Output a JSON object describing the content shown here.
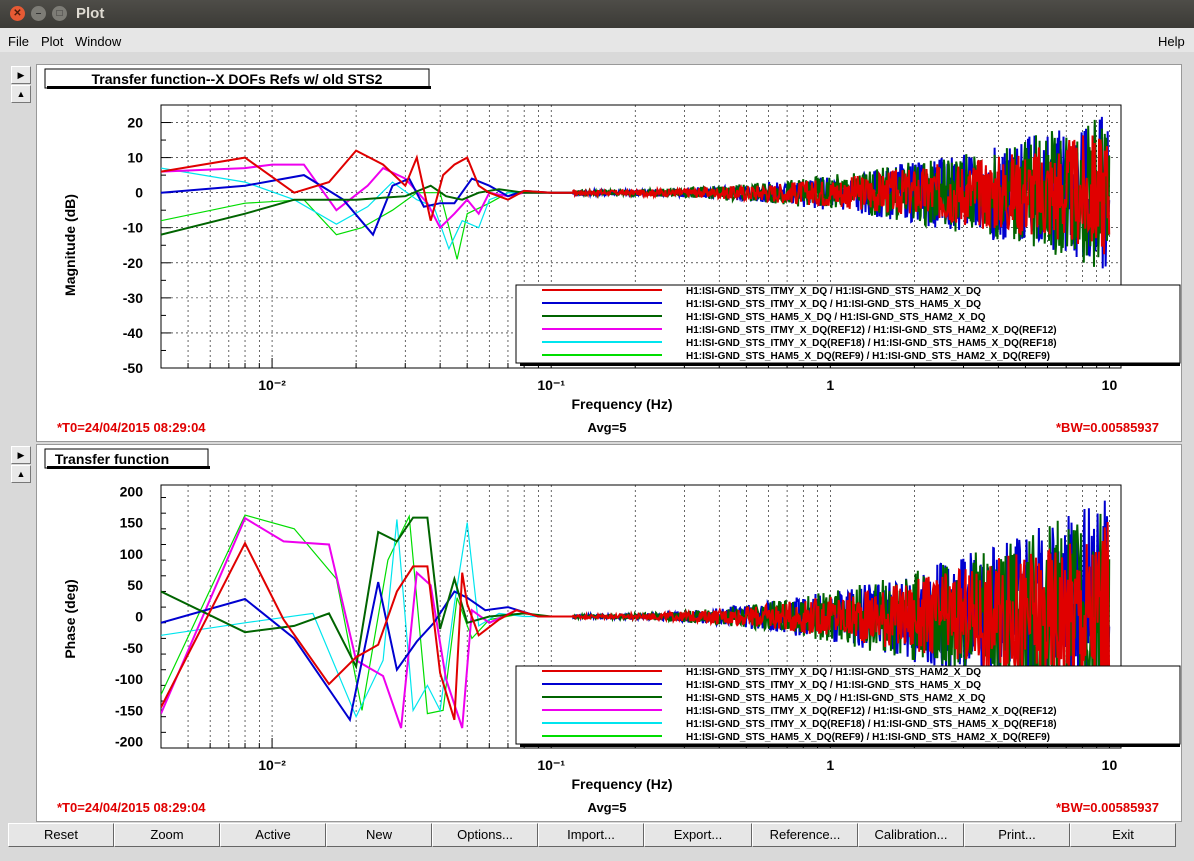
{
  "window": {
    "title": "Plot"
  },
  "menu": {
    "file": "File",
    "plot": "Plot",
    "window": "Window",
    "help": "Help"
  },
  "panels": [
    {
      "title": "Transfer function--X DOFs  Refs w/ old STS2",
      "ylabel": "Magnitude (dB)",
      "xlabel": "Frequency (Hz)",
      "yticks": [
        "20",
        "10",
        "0",
        "-10",
        "-20",
        "-30",
        "-40",
        "-50"
      ],
      "xticks": [
        "10⁻²",
        "10⁻¹",
        "1",
        "10"
      ],
      "t0": "*T0=24/04/2015 08:29:04",
      "avg": "Avg=5",
      "bw": "*BW=0.00585937",
      "legend": [
        {
          "label": "H1:ISI-GND_STS_ITMY_X_DQ / H1:ISI-GND_STS_HAM2_X_DQ",
          "color": "#e00000"
        },
        {
          "label": "H1:ISI-GND_STS_ITMY_X_DQ / H1:ISI-GND_STS_HAM5_X_DQ",
          "color": "#0000d0"
        },
        {
          "label": "H1:ISI-GND_STS_HAM5_X_DQ / H1:ISI-GND_STS_HAM2_X_DQ",
          "color": "#006400"
        },
        {
          "label": "H1:ISI-GND_STS_ITMY_X_DQ(REF12) / H1:ISI-GND_STS_HAM2_X_DQ(REF12)",
          "color": "#ee00ee"
        },
        {
          "label": "H1:ISI-GND_STS_ITMY_X_DQ(REF18) / H1:ISI-GND_STS_HAM5_X_DQ(REF18)",
          "color": "#00e5ee"
        },
        {
          "label": "H1:ISI-GND_STS_HAM5_X_DQ(REF9) / H1:ISI-GND_STS_HAM2_X_DQ(REF9)",
          "color": "#00dd00"
        }
      ]
    },
    {
      "title": "Transfer function",
      "ylabel": "Phase (deg)",
      "xlabel": "Frequency (Hz)",
      "yticks": [
        "200",
        "150",
        "100",
        "50",
        "0",
        "-50",
        "-100",
        "-150",
        "-200"
      ],
      "xticks": [
        "10⁻²",
        "10⁻¹",
        "1",
        "10"
      ],
      "t0": "*T0=24/04/2015 08:29:04",
      "avg": "Avg=5",
      "bw": "*BW=0.00585937",
      "legend": [
        {
          "label": "H1:ISI-GND_STS_ITMY_X_DQ / H1:ISI-GND_STS_HAM2_X_DQ",
          "color": "#e00000"
        },
        {
          "label": "H1:ISI-GND_STS_ITMY_X_DQ / H1:ISI-GND_STS_HAM5_X_DQ",
          "color": "#0000d0"
        },
        {
          "label": "H1:ISI-GND_STS_HAM5_X_DQ / H1:ISI-GND_STS_HAM2_X_DQ",
          "color": "#006400"
        },
        {
          "label": "H1:ISI-GND_STS_ITMY_X_DQ(REF12) / H1:ISI-GND_STS_HAM2_X_DQ(REF12)",
          "color": "#ee00ee"
        },
        {
          "label": "H1:ISI-GND_STS_ITMY_X_DQ(REF18) / H1:ISI-GND_STS_HAM5_X_DQ(REF18)",
          "color": "#00e5ee"
        },
        {
          "label": "H1:ISI-GND_STS_HAM5_X_DQ(REF9) / H1:ISI-GND_STS_HAM2_X_DQ(REF9)",
          "color": "#00dd00"
        }
      ]
    }
  ],
  "buttons": [
    "Reset",
    "Zoom",
    "Active",
    "New",
    "Options...",
    "Import...",
    "Export...",
    "Reference...",
    "Calibration...",
    "Print...",
    "Exit"
  ],
  "chart_data": [
    {
      "type": "line",
      "x_scale": "log",
      "xlim": [
        0.004,
        11
      ],
      "ylim": [
        -50,
        25
      ],
      "series": [
        {
          "name": "H1:ISI-GND_STS_ITMY_X_DQ / H1:ISI-GND_STS_HAM2_X_DQ",
          "color": "#e00000",
          "points": [
            [
              0.004,
              6
            ],
            [
              0.008,
              10
            ],
            [
              0.012,
              0
            ],
            [
              0.016,
              3
            ],
            [
              0.02,
              12
            ],
            [
              0.025,
              8
            ],
            [
              0.03,
              2
            ],
            [
              0.033,
              10
            ],
            [
              0.037,
              -8
            ],
            [
              0.041,
              5
            ],
            [
              0.045,
              8
            ],
            [
              0.05,
              10
            ],
            [
              0.055,
              2
            ],
            [
              0.06,
              0
            ],
            [
              0.07,
              -2
            ],
            [
              0.08,
              0.5
            ],
            [
              0.1,
              0
            ],
            [
              0.12,
              0
            ]
          ]
        },
        {
          "name": "H1:ISI-GND_STS_ITMY_X_DQ / H1:ISI-GND_STS_HAM5_X_DQ",
          "color": "#0000d0",
          "points": [
            [
              0.004,
              0
            ],
            [
              0.008,
              2
            ],
            [
              0.013,
              5
            ],
            [
              0.018,
              -2
            ],
            [
              0.023,
              -12
            ],
            [
              0.027,
              2
            ],
            [
              0.031,
              4
            ],
            [
              0.035,
              -4
            ],
            [
              0.04,
              -3
            ],
            [
              0.045,
              -3
            ],
            [
              0.052,
              4
            ],
            [
              0.06,
              2
            ],
            [
              0.07,
              -1
            ],
            [
              0.08,
              0.5
            ],
            [
              0.1,
              0
            ],
            [
              0.12,
              0
            ]
          ]
        },
        {
          "name": "H1:ISI-GND_STS_HAM5_X_DQ / H1:ISI-GND_STS_HAM2_X_DQ",
          "color": "#006400",
          "points": [
            [
              0.004,
              -12
            ],
            [
              0.008,
              -6
            ],
            [
              0.012,
              -2
            ],
            [
              0.02,
              -2
            ],
            [
              0.03,
              -1
            ],
            [
              0.037,
              2
            ],
            [
              0.042,
              -1
            ],
            [
              0.048,
              -2
            ],
            [
              0.055,
              0
            ],
            [
              0.065,
              1
            ],
            [
              0.08,
              0
            ],
            [
              0.1,
              0
            ],
            [
              0.12,
              0
            ]
          ]
        },
        {
          "name": "H1:ISI-GND_STS_ITMY_X_DQ(REF12) / H1:ISI-GND_STS_HAM2_X_DQ(REF12)",
          "color": "#ee00ee",
          "points": [
            [
              0.004,
              6
            ],
            [
              0.008,
              7
            ],
            [
              0.01,
              8
            ],
            [
              0.013,
              8
            ],
            [
              0.017,
              -5
            ],
            [
              0.022,
              2
            ],
            [
              0.025,
              7
            ],
            [
              0.03,
              4
            ],
            [
              0.036,
              -3
            ],
            [
              0.04,
              -10
            ],
            [
              0.045,
              -6
            ],
            [
              0.05,
              -2
            ],
            [
              0.055,
              -6
            ],
            [
              0.06,
              0
            ],
            [
              0.07,
              -1
            ],
            [
              0.08,
              0
            ],
            [
              0.1,
              0
            ],
            [
              0.12,
              0
            ]
          ]
        },
        {
          "name": "H1:ISI-GND_STS_ITMY_X_DQ(REF18) / H1:ISI-GND_STS_HAM5_X_DQ(REF18)",
          "color": "#00e5ee",
          "points": [
            [
              0.004,
              7
            ],
            [
              0.008,
              3
            ],
            [
              0.012,
              -2
            ],
            [
              0.017,
              -9
            ],
            [
              0.022,
              -4
            ],
            [
              0.027,
              3
            ],
            [
              0.033,
              -2
            ],
            [
              0.038,
              -4
            ],
            [
              0.043,
              -16
            ],
            [
              0.048,
              -8
            ],
            [
              0.055,
              -10
            ],
            [
              0.06,
              -2
            ],
            [
              0.07,
              0
            ],
            [
              0.08,
              0
            ],
            [
              0.1,
              0
            ],
            [
              0.12,
              0
            ]
          ]
        },
        {
          "name": "H1:ISI-GND_STS_HAM5_X_DQ(REF9) / H1:ISI-GND_STS_HAM2_X_DQ(REF9)",
          "color": "#00dd00",
          "points": [
            [
              0.004,
              -8
            ],
            [
              0.008,
              -3
            ],
            [
              0.013,
              -2
            ],
            [
              0.017,
              -12
            ],
            [
              0.021,
              -10
            ],
            [
              0.027,
              -5
            ],
            [
              0.033,
              0
            ],
            [
              0.04,
              0
            ],
            [
              0.046,
              -19
            ],
            [
              0.05,
              -6
            ],
            [
              0.06,
              -3
            ],
            [
              0.07,
              0
            ],
            [
              0.08,
              0
            ],
            [
              0.1,
              0
            ],
            [
              0.12,
              0
            ]
          ]
        }
      ]
    },
    {
      "type": "line",
      "x_scale": "log",
      "xlim": [
        0.004,
        11
      ],
      "ylim": [
        -210,
        210
      ],
      "series": [
        {
          "name": "H1:ISI-GND_STS_ITMY_X_DQ / H1:ISI-GND_STS_HAM2_X_DQ",
          "color": "#e00000",
          "points": [
            [
              0.004,
              -145
            ],
            [
              0.008,
              117
            ],
            [
              0.011,
              -5
            ],
            [
              0.016,
              -108
            ],
            [
              0.02,
              -65
            ],
            [
              0.024,
              -45
            ],
            [
              0.028,
              40
            ],
            [
              0.032,
              80
            ],
            [
              0.036,
              80
            ],
            [
              0.04,
              -90
            ],
            [
              0.045,
              -165
            ],
            [
              0.048,
              70
            ],
            [
              0.05,
              20
            ],
            [
              0.055,
              -30
            ],
            [
              0.065,
              -5
            ],
            [
              0.075,
              10
            ],
            [
              0.09,
              0
            ],
            [
              0.12,
              0
            ]
          ]
        },
        {
          "name": "H1:ISI-GND_STS_ITMY_X_DQ / H1:ISI-GND_STS_HAM5_X_DQ",
          "color": "#0000d0",
          "points": [
            [
              0.004,
              -10
            ],
            [
              0.008,
              28
            ],
            [
              0.012,
              -35
            ],
            [
              0.019,
              -165
            ],
            [
              0.024,
              55
            ],
            [
              0.028,
              -85
            ],
            [
              0.033,
              -40
            ],
            [
              0.038,
              -10
            ],
            [
              0.045,
              40
            ],
            [
              0.05,
              30
            ],
            [
              0.058,
              10
            ],
            [
              0.07,
              15
            ],
            [
              0.09,
              0
            ],
            [
              0.12,
              0
            ]
          ]
        },
        {
          "name": "H1:ISI-GND_STS_HAM5_X_DQ / H1:ISI-GND_STS_HAM2_X_DQ",
          "color": "#006400",
          "points": [
            [
              0.004,
              40
            ],
            [
              0.008,
              -25
            ],
            [
              0.012,
              -15
            ],
            [
              0.016,
              5
            ],
            [
              0.02,
              -80
            ],
            [
              0.024,
              135
            ],
            [
              0.028,
              120
            ],
            [
              0.032,
              158
            ],
            [
              0.036,
              158
            ],
            [
              0.04,
              -20
            ],
            [
              0.045,
              60
            ],
            [
              0.05,
              -10
            ],
            [
              0.06,
              0
            ],
            [
              0.08,
              5
            ],
            [
              0.1,
              0
            ],
            [
              0.12,
              0
            ]
          ]
        },
        {
          "name": "H1:ISI-GND_STS_ITMY_X_DQ(REF12) / H1:ISI-GND_STS_HAM2_X_DQ(REF12)",
          "color": "#ee00ee",
          "points": [
            [
              0.004,
              -155
            ],
            [
              0.008,
              157
            ],
            [
              0.011,
              120
            ],
            [
              0.016,
              115
            ],
            [
              0.02,
              -70
            ],
            [
              0.025,
              -95
            ],
            [
              0.029,
              -178
            ],
            [
              0.033,
              70
            ],
            [
              0.037,
              50
            ],
            [
              0.042,
              -100
            ],
            [
              0.048,
              -178
            ],
            [
              0.052,
              10
            ],
            [
              0.06,
              -10
            ],
            [
              0.075,
              10
            ],
            [
              0.09,
              0
            ],
            [
              0.12,
              0
            ]
          ]
        },
        {
          "name": "H1:ISI-GND_STS_ITMY_X_DQ(REF18) / H1:ISI-GND_STS_HAM5_X_DQ(REF18)",
          "color": "#00e5ee",
          "points": [
            [
              0.004,
              -30
            ],
            [
              0.008,
              -10
            ],
            [
              0.014,
              5
            ],
            [
              0.02,
              -160
            ],
            [
              0.025,
              -70
            ],
            [
              0.028,
              155
            ],
            [
              0.032,
              -150
            ],
            [
              0.036,
              -110
            ],
            [
              0.04,
              -150
            ],
            [
              0.045,
              20
            ],
            [
              0.05,
              150
            ],
            [
              0.055,
              -15
            ],
            [
              0.065,
              5
            ],
            [
              0.08,
              0
            ],
            [
              0.1,
              0
            ],
            [
              0.12,
              0
            ]
          ]
        },
        {
          "name": "H1:ISI-GND_STS_HAM5_X_DQ(REF9) / H1:ISI-GND_STS_HAM2_X_DQ(REF9)",
          "color": "#00dd00",
          "points": [
            [
              0.004,
              -125
            ],
            [
              0.008,
              162
            ],
            [
              0.012,
              140
            ],
            [
              0.017,
              60
            ],
            [
              0.021,
              -150
            ],
            [
              0.026,
              90
            ],
            [
              0.031,
              160
            ],
            [
              0.036,
              -155
            ],
            [
              0.041,
              -150
            ],
            [
              0.046,
              30
            ],
            [
              0.052,
              -35
            ],
            [
              0.06,
              -5
            ],
            [
              0.08,
              5
            ],
            [
              0.1,
              0
            ],
            [
              0.12,
              0
            ]
          ]
        }
      ]
    }
  ]
}
